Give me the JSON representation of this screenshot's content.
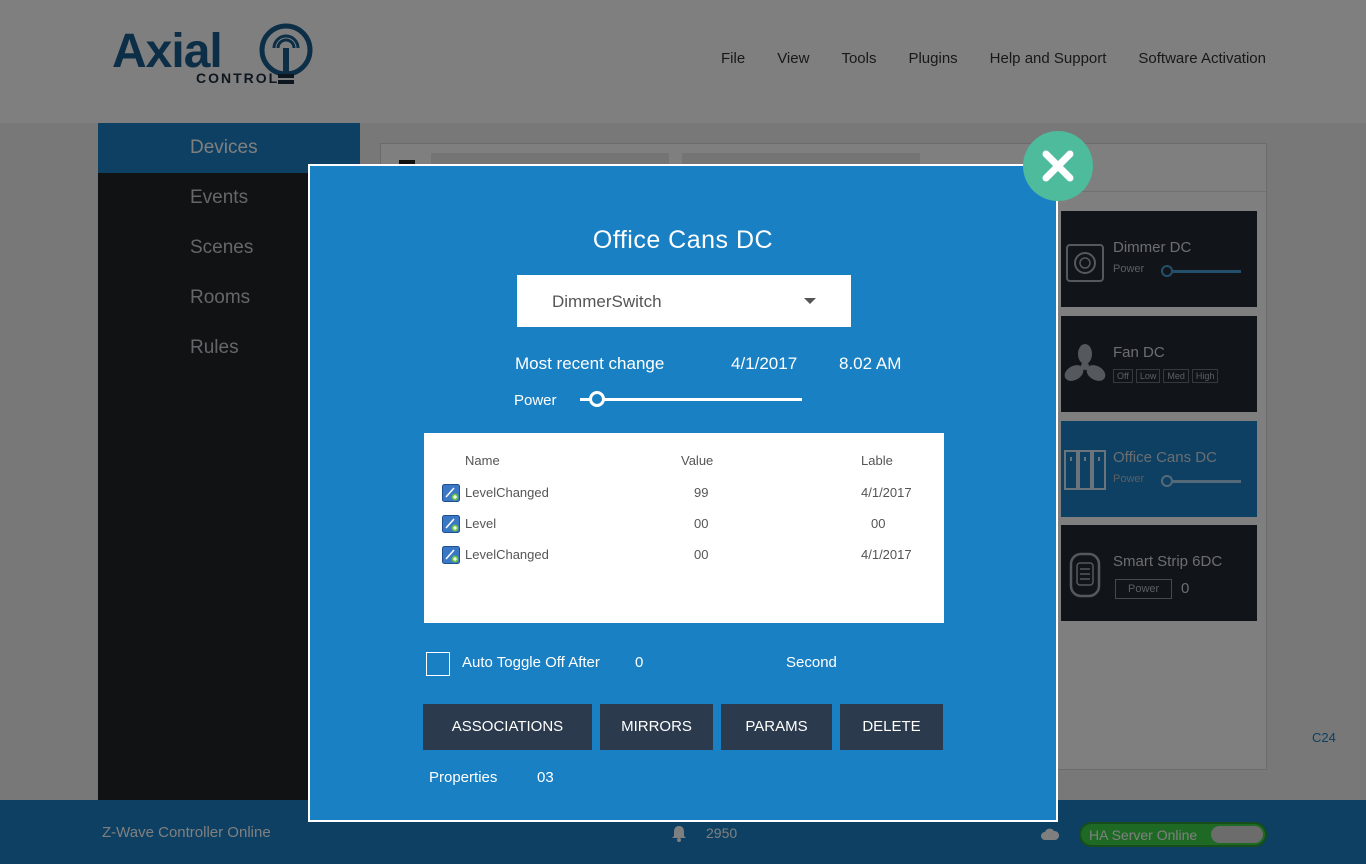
{
  "brand": {
    "name": "Axial",
    "sub": "CONTROL"
  },
  "menu": [
    "File",
    "View",
    "Tools",
    "Plugins",
    "Help and Support",
    "Software Activation"
  ],
  "sidebar": {
    "items": [
      {
        "label": "Devices",
        "active": true
      },
      {
        "label": "Events"
      },
      {
        "label": "Scenes"
      },
      {
        "label": "Rooms"
      },
      {
        "label": "Rules"
      }
    ]
  },
  "device_cards": [
    {
      "title": "Dimmer DC",
      "sub": "Power",
      "icon": "dial-icon"
    },
    {
      "title": "Fan DC",
      "buttons": [
        "Off",
        "Low",
        "Med",
        "High"
      ],
      "icon": "fan-icon"
    },
    {
      "title": "Office Cans DC",
      "sub": "Power",
      "icon": "cans-icon",
      "active": true
    },
    {
      "title": "Smart Strip 6DC",
      "button": "Power",
      "value": "0",
      "icon": "strip-icon"
    }
  ],
  "content": {
    "corner_label": "C24"
  },
  "footer": {
    "status": "Z-Wave Controller Online",
    "notifications": "2950",
    "ha_status": "HA Server Online"
  },
  "modal": {
    "title": "Office Cans DC",
    "device_type": "DimmerSwitch",
    "recent_label": "Most recent change",
    "recent_date": "4/1/2017",
    "recent_time": "8.02 AM",
    "power_label": "Power",
    "power_level": 0.04,
    "table": {
      "headers": {
        "name": "Name",
        "value": "Value",
        "label": "Lable"
      },
      "rows": [
        {
          "name": "LevelChanged",
          "value": "99",
          "label": "4/1/2017"
        },
        {
          "name": "Level",
          "value": "00",
          "label": "00"
        },
        {
          "name": "LevelChanged",
          "value": "00",
          "label": "4/1/2017"
        }
      ]
    },
    "auto_toggle": {
      "label": "Auto Toggle Off After",
      "value": "0",
      "unit": "Second"
    },
    "buttons": {
      "associations": "ASSOCIATIONS",
      "mirrors": "MIRRORS",
      "params": "PARAMS",
      "delete": "DELETE"
    },
    "properties": {
      "label": "Properties",
      "value": "03"
    }
  },
  "colors": {
    "accent": "#1a80c4",
    "close": "#4dbb9c",
    "button": "#2b3a4d",
    "sidebar": "#202428"
  }
}
